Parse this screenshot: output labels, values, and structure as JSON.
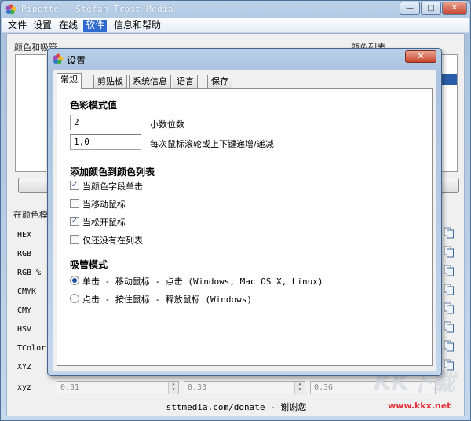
{
  "window": {
    "title": "Pipette - Stefan Trost Media",
    "minimize": "—",
    "maximize": "□",
    "close": "✕"
  },
  "menu": [
    "文件",
    "设置",
    "在线",
    "软件",
    "信息和帮助"
  ],
  "main": {
    "color_pick_group": "颜色和吸管",
    "color_list_group": "颜色列表",
    "formats_group": "在颜色模",
    "rows": [
      "HEX",
      "RGB",
      "RGB %",
      "CMYK",
      "CMY",
      "HSV",
      "TColor",
      "XYZ",
      "xyz"
    ],
    "xyz_values": [
      "0.31",
      "0.33",
      "0.36"
    ],
    "footer": "sttmedia.com/donate - 谢谢您"
  },
  "dialog": {
    "title": "设置",
    "close": "✕",
    "tabs": [
      "常规",
      "剪贴板",
      "系统信息",
      "语言",
      "保存"
    ],
    "color_mode_heading": "色彩模式值",
    "decimals_value": "2",
    "decimals_label": "小数位数",
    "step_value": "1,0",
    "step_label": "每次鼠标滚轮或上下键递增/递减",
    "add_heading": "添加颜色到颜色列表",
    "add_options": [
      {
        "label": "当颜色字段单击",
        "checked": true
      },
      {
        "label": "当移动鼠标",
        "checked": false
      },
      {
        "label": "当松开鼠标",
        "checked": true
      },
      {
        "label": "仅还没有在列表",
        "checked": false
      }
    ],
    "pipette_heading": "吸管模式",
    "pipette_options": [
      {
        "label": "单击 - 移动鼠标 - 点击 (Windows, Mac OS X, Linux)",
        "selected": true
      },
      {
        "label": "点击 - 按住鼠标 - 释放鼠标 (Windows)",
        "selected": false
      }
    ]
  },
  "watermark": {
    "text": "KK下载",
    "url": "www.kkx.net"
  },
  "colors": {
    "accent": "#2e6bcf",
    "title_gradient": "#b9cfe7",
    "close_red": "#c8432c"
  }
}
